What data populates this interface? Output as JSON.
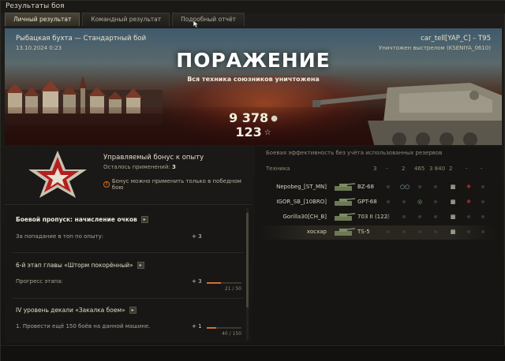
{
  "window": {
    "title": "Результаты боя"
  },
  "tabs": [
    {
      "label": "Личный результат",
      "active": true
    },
    {
      "label": "Командный результат",
      "active": false
    },
    {
      "label": "Подробный отчёт",
      "active": false
    }
  ],
  "banner": {
    "map": "Рыбацкая бухта — Стандартный бой",
    "date": "13.10.2024 0:23",
    "player": "car_tell[YAP_C] – T95",
    "killed_by": "Уничтожен выстрелом (KSENIYA_0610)",
    "result": "ПОРАЖЕНИЕ",
    "result_sub": "Вся техника союзников уничтожена",
    "credits": "9 378",
    "xp": "123",
    "credits_icon": "credits-icon",
    "xp_icon": "star-icon"
  },
  "bonus": {
    "title": "Управляемый бонус к опыту",
    "remaining_label": "Осталось применений:",
    "remaining_value": "3",
    "warning": "Бонус можно применить только в победном бою"
  },
  "progress": {
    "battle_pass": {
      "title": "Боевой пропуск: начисление очков",
      "row_label": "За попадание в топ по опыту:",
      "row_value": "+ 3"
    },
    "chapter": {
      "title": "6-й этап главы «Шторм покорённый»",
      "row_label": "Прогресс этапа:",
      "row_value": "+ 3",
      "bar_text": "21 / 50",
      "bar_fraction": 0.42
    },
    "decal": {
      "title": "IV уровень декали «Закалка боем»",
      "row_label": "1. Провести ещё 150 боёв на данной машине.",
      "row_value": "+ 1",
      "bar_text": "40 / 150",
      "bar_fraction": 0.27
    }
  },
  "efficiency": {
    "title": "Боевая эффективность без учёта использованных резервов",
    "header": {
      "vehicle": "Техника",
      "c1": "3",
      "c2": "-",
      "c3": "2",
      "c4": "465",
      "c5": "3 840",
      "c6": "2",
      "c7": "-",
      "c8": "-"
    },
    "rows": [
      {
        "player": "Nepobeg_[ST_MN]",
        "tank": "BZ-68"
      },
      {
        "player": "IGOR_SB_[10BRO]",
        "tank": "GPT-68"
      },
      {
        "player": "Gorilla30[CH_B]",
        "tank": "703 II (122)"
      },
      {
        "player": "хосхар",
        "tank": "TS-5"
      }
    ]
  },
  "colors": {
    "accent_orange": "#d2702f",
    "defeat_red": "#b02020",
    "text_main": "#c9c4b4"
  }
}
